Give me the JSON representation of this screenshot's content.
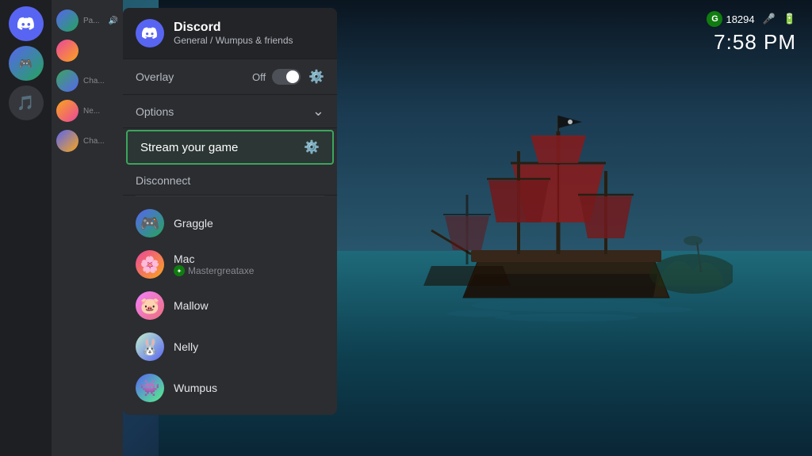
{
  "background": {
    "scene": "Sea of Thieves pirate ships"
  },
  "system_tray": {
    "score": "18294",
    "time": "7:58 PM",
    "mic_label": "microphone",
    "battery_label": "battery"
  },
  "discord": {
    "app_name": "Discord",
    "channel": "General / Wumpus & friends",
    "overlay_label": "Overlay",
    "overlay_status": "Off",
    "options_label": "Options",
    "stream_label": "Stream your game",
    "disconnect_label": "Disconnect",
    "members": [
      {
        "name": "Graggle",
        "game": "",
        "avatar_class": "av-graggle",
        "emoji": "🎮"
      },
      {
        "name": "Mac",
        "game": "Mastergreataxe",
        "has_xbox": true,
        "avatar_class": "av-mac",
        "emoji": "🌸"
      },
      {
        "name": "Mallow",
        "game": "",
        "avatar_class": "av-mallow",
        "emoji": "🐷"
      },
      {
        "name": "Nelly",
        "game": "",
        "avatar_class": "av-nelly",
        "emoji": "🐰"
      },
      {
        "name": "Wumpus",
        "game": "",
        "avatar_class": "av-wumpus",
        "emoji": "👾"
      }
    ]
  },
  "sidebar": {
    "icons": [
      "🎮",
      "🎵",
      "🔊"
    ],
    "channels": [
      {
        "label": "Pa...",
        "avatar_class": "av-s1",
        "has_sound": true
      },
      {
        "label": "",
        "avatar_class": "av-s2",
        "has_sound": false
      },
      {
        "label": "Cha...",
        "avatar_class": "av-s3",
        "has_sound": false
      },
      {
        "label": "Ne...",
        "avatar_class": "av-s4",
        "has_sound": false
      },
      {
        "label": "Cha...",
        "avatar_class": "av-s5",
        "has_sound": false
      }
    ]
  }
}
